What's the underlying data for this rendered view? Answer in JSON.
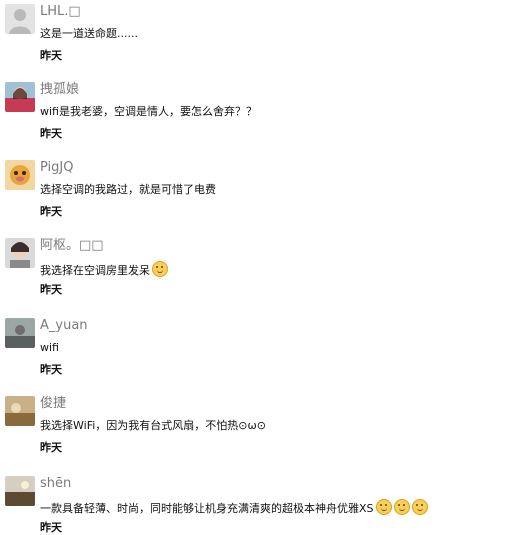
{
  "comments": [
    {
      "name": "LHL.□",
      "text": "这是一道送命题......",
      "time": "昨天",
      "avatar": "default-avatar-icon"
    },
    {
      "name": "拽孤娘",
      "text": "wifi是我老婆，空调是情人，要怎么舍弃？？",
      "time": "昨天",
      "avatar": "avatar-photo"
    },
    {
      "name": "PigJQ",
      "text": "选择空调的我路过，就是可惜了电费",
      "time": "昨天",
      "avatar": "avatar-photo"
    },
    {
      "name": "阿枢。□□",
      "text": "我选择在空调房里发呆",
      "time": "昨天",
      "avatar": "avatar-photo",
      "emoji_count": 1
    },
    {
      "name": "A_yuan",
      "text": "wifi",
      "time": "昨天",
      "avatar": "avatar-photo"
    },
    {
      "name": "俊捷",
      "text": "我选择WiFi，因为我有台式风扇，不怕热⊙ω⊙",
      "time": "昨天",
      "avatar": "avatar-photo"
    },
    {
      "name": "shēn",
      "text": "一款具备轻薄、时尚，同时能够让机身充满清爽的超极本神舟优雅XS",
      "time": "昨天",
      "avatar": "avatar-photo",
      "emoji_count": 3
    }
  ]
}
